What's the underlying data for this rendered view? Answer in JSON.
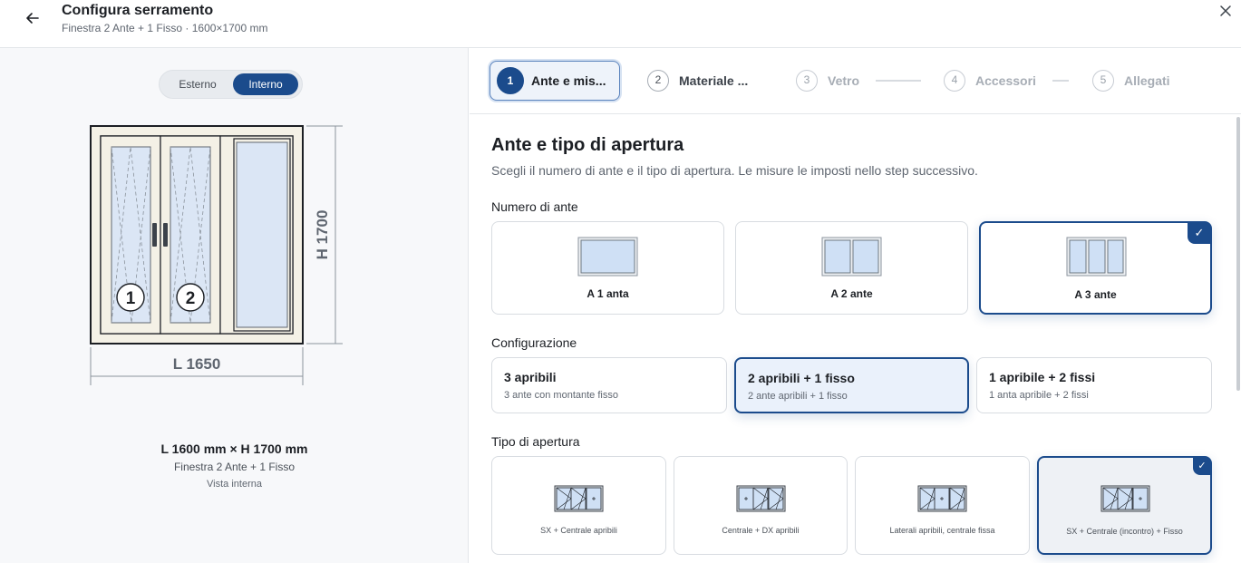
{
  "header": {
    "title": "Configura serramento",
    "subtitle": "Finestra 2 Ante + 1 Fisso · 1600×1700 mm"
  },
  "view_toggle": {
    "options": [
      "Esterno",
      "Interno"
    ],
    "selected": "Interno"
  },
  "drawing": {
    "width_label": "L 1650",
    "height_label": "H 1700",
    "sash_numbers": [
      "1",
      "2"
    ]
  },
  "summary": {
    "dimensions": "L 1600 mm × H 1700 mm",
    "type": "Finestra 2 Ante + 1 Fisso",
    "view": "Vista interna"
  },
  "steps": [
    {
      "num": "1",
      "label": "Ante e mis...",
      "state": "active"
    },
    {
      "num": "2",
      "label": "Materiale ...",
      "state": "upcoming"
    },
    {
      "num": "3",
      "label": "Vetro",
      "state": "disabled"
    },
    {
      "num": "4",
      "label": "Accessori",
      "state": "disabled"
    },
    {
      "num": "5",
      "label": "Allegati",
      "state": "disabled"
    }
  ],
  "main": {
    "title": "Ante e tipo di apertura",
    "description": "Scegli il numero di ante e il tipo di apertura. Le misure le imposti nello step successivo.",
    "numero_ante": {
      "label": "Numero di ante",
      "options": [
        "A 1 anta",
        "A 2 ante",
        "A 3 ante"
      ],
      "selected": "A 3 ante"
    },
    "configurazione": {
      "label": "Configurazione",
      "options": [
        {
          "title": "3 apribili",
          "subtitle": "3 ante con montante fisso"
        },
        {
          "title": "2 apribili + 1 fisso",
          "subtitle": "2 ante apribili + 1 fisso"
        },
        {
          "title": "1 apribile + 2 fissi",
          "subtitle": "1 anta apribile + 2 fissi"
        }
      ],
      "selected": "2 apribili + 1 fisso"
    },
    "tipo_apertura": {
      "label": "Tipo di apertura",
      "options": [
        "SX + Centrale apribili",
        "Centrale + DX apribili",
        "Laterali apribili, centrale fissa",
        "SX + Centrale (incontro) + Fisso"
      ],
      "selected": "SX + Centrale (incontro) + Fisso"
    }
  },
  "icons": {
    "back": "arrow-left-icon",
    "close": "close-icon",
    "check": "check-icon"
  },
  "colors": {
    "accent": "#1b4b8c",
    "glass": "#dbe6f5"
  }
}
